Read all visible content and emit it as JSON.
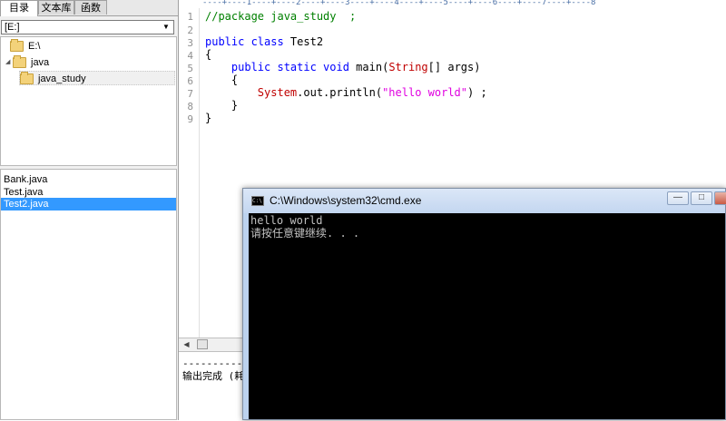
{
  "left_panel": {
    "tabs": [
      "目录",
      "文本库",
      "函数"
    ],
    "drive_select": "[E:]",
    "tree": [
      {
        "label": "E:\\",
        "level": 0
      },
      {
        "label": "java",
        "level": 1
      },
      {
        "label": "java_study",
        "level": 2
      }
    ],
    "files": [
      "Bank.java",
      "Test.java",
      "Test2.java"
    ],
    "selected_file": "Test2.java"
  },
  "editor": {
    "ruler": "----+----1----+----2----+----3----+----4----+----5----+----6----+----7----+----8",
    "line_numbers": [
      "1",
      "2",
      "3",
      "4",
      "5",
      "6",
      "7",
      "8",
      "9"
    ],
    "code": {
      "l1": "//package java_study  ;",
      "l3_kw": "public class",
      "l3_name": " Test2",
      "l4": "{",
      "l5_indent": "    ",
      "l5_kw": "public static void",
      "l5_mid": " main(",
      "l5_type": "String",
      "l5_end": "[] args)",
      "l6": "    {",
      "l7_indent": "        ",
      "l7_type": "System",
      "l7_mid": ".out.println(",
      "l7_str": "\"hello world\"",
      "l7_end": ") ;",
      "l8": "    }",
      "l9": "}"
    }
  },
  "output": {
    "line1": "---------- ",
    "line2": "输出完成 (耗"
  },
  "cmd": {
    "title": "C:\\Windows\\system32\\cmd.exe",
    "icon_text": "C:\\",
    "lines": [
      "hello world",
      "请按任意键继续. . ."
    ],
    "buttons": {
      "minimize": "—",
      "maximize": "□"
    }
  },
  "colors": {
    "keyword": "#0000ff",
    "comment": "#008000",
    "type": "#c00000",
    "string": "#e000e0",
    "selection": "#3399ff",
    "console_bg": "#000000",
    "console_fg": "#c0c0c0"
  }
}
